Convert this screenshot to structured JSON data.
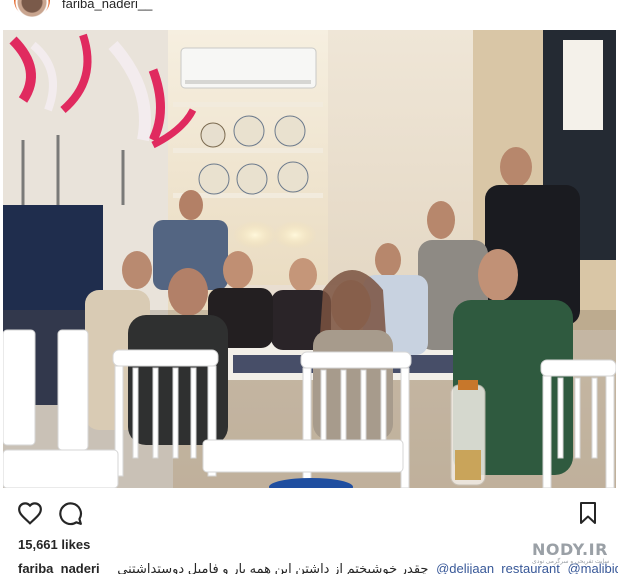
{
  "header": {
    "username": "fariba_naderi__"
  },
  "post": {
    "likes_count": "15,661",
    "likes_label": "likes",
    "caption_user": "fariba_naderi",
    "caption_text": "چقدر خوشبختم از داشتن این همه یار و فامیل دوستداشتنی",
    "mention_1": "@delijaan_restaurant",
    "mention_2": "@malibidoli"
  },
  "actions": {
    "like": "heart-icon",
    "comment": "comment-icon",
    "save": "bookmark-icon"
  },
  "watermark": {
    "brand": "NODY.IR",
    "subtitle": "سایت تفریحی و سرگرمی نودی"
  },
  "colors": {
    "link": "#385898",
    "text": "#262626"
  }
}
